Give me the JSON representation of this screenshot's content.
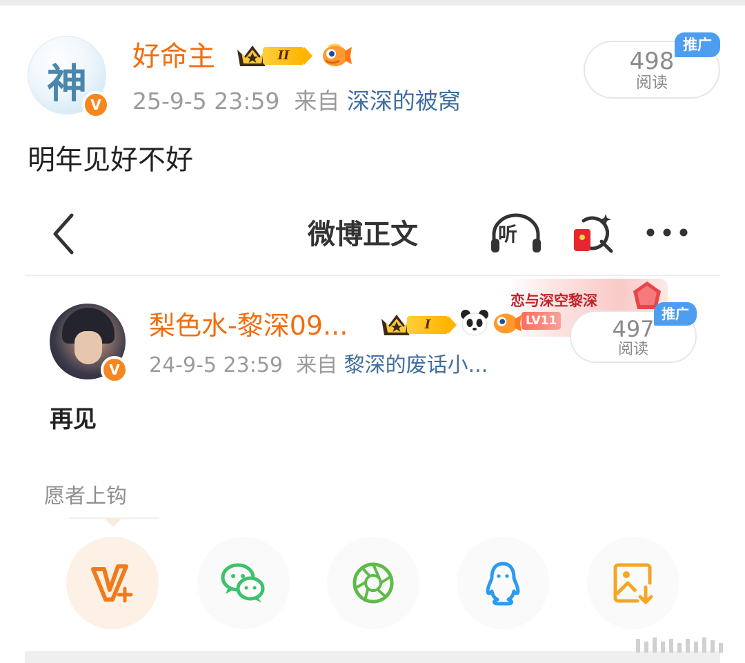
{
  "outer_post": {
    "avatar_glyph": "神",
    "username": "好命主",
    "level_badge": "II",
    "timestamp": "25-9-5 23:59",
    "from_label": "来自",
    "source": "深深的被窝",
    "read_count": "498",
    "read_label": "阅读",
    "promo_tag": "推广",
    "content": "明年见好不好"
  },
  "screenshot": {
    "nav": {
      "title": "微博正文",
      "listen_label": "听",
      "icons": [
        "back-icon",
        "listen-headphone-icon",
        "red-packet-search-icon",
        "more-icon"
      ]
    },
    "post": {
      "username": "梨色水-黎深09...",
      "level_badge": "I",
      "promo_banner": "恋与深空黎深",
      "level_tag": "LV11",
      "timestamp": "24-9-5 23:59",
      "from_label": "来自",
      "source": "黎深的废话小...",
      "read_count": "497",
      "read_label": "阅读",
      "promo_tag": "推广",
      "content": "再见"
    },
    "share": {
      "label": "愿者上钩",
      "buttons": [
        {
          "name": "weibo-vplus",
          "icon": "vplus-icon",
          "color": "#f27a1a"
        },
        {
          "name": "wechat",
          "icon": "wechat-icon",
          "color": "#3cc26a"
        },
        {
          "name": "moments",
          "icon": "moments-icon",
          "color": "#5dbb47"
        },
        {
          "name": "qq",
          "icon": "qq-icon",
          "color": "#2a9bf0"
        },
        {
          "name": "save-image",
          "icon": "save-image-icon",
          "color": "#f5a623"
        }
      ]
    }
  },
  "colors": {
    "username": "#f26d0d",
    "link": "#3f6da0",
    "promo_blue": "#4d9ef0",
    "verified_orange": "#f7861f"
  }
}
